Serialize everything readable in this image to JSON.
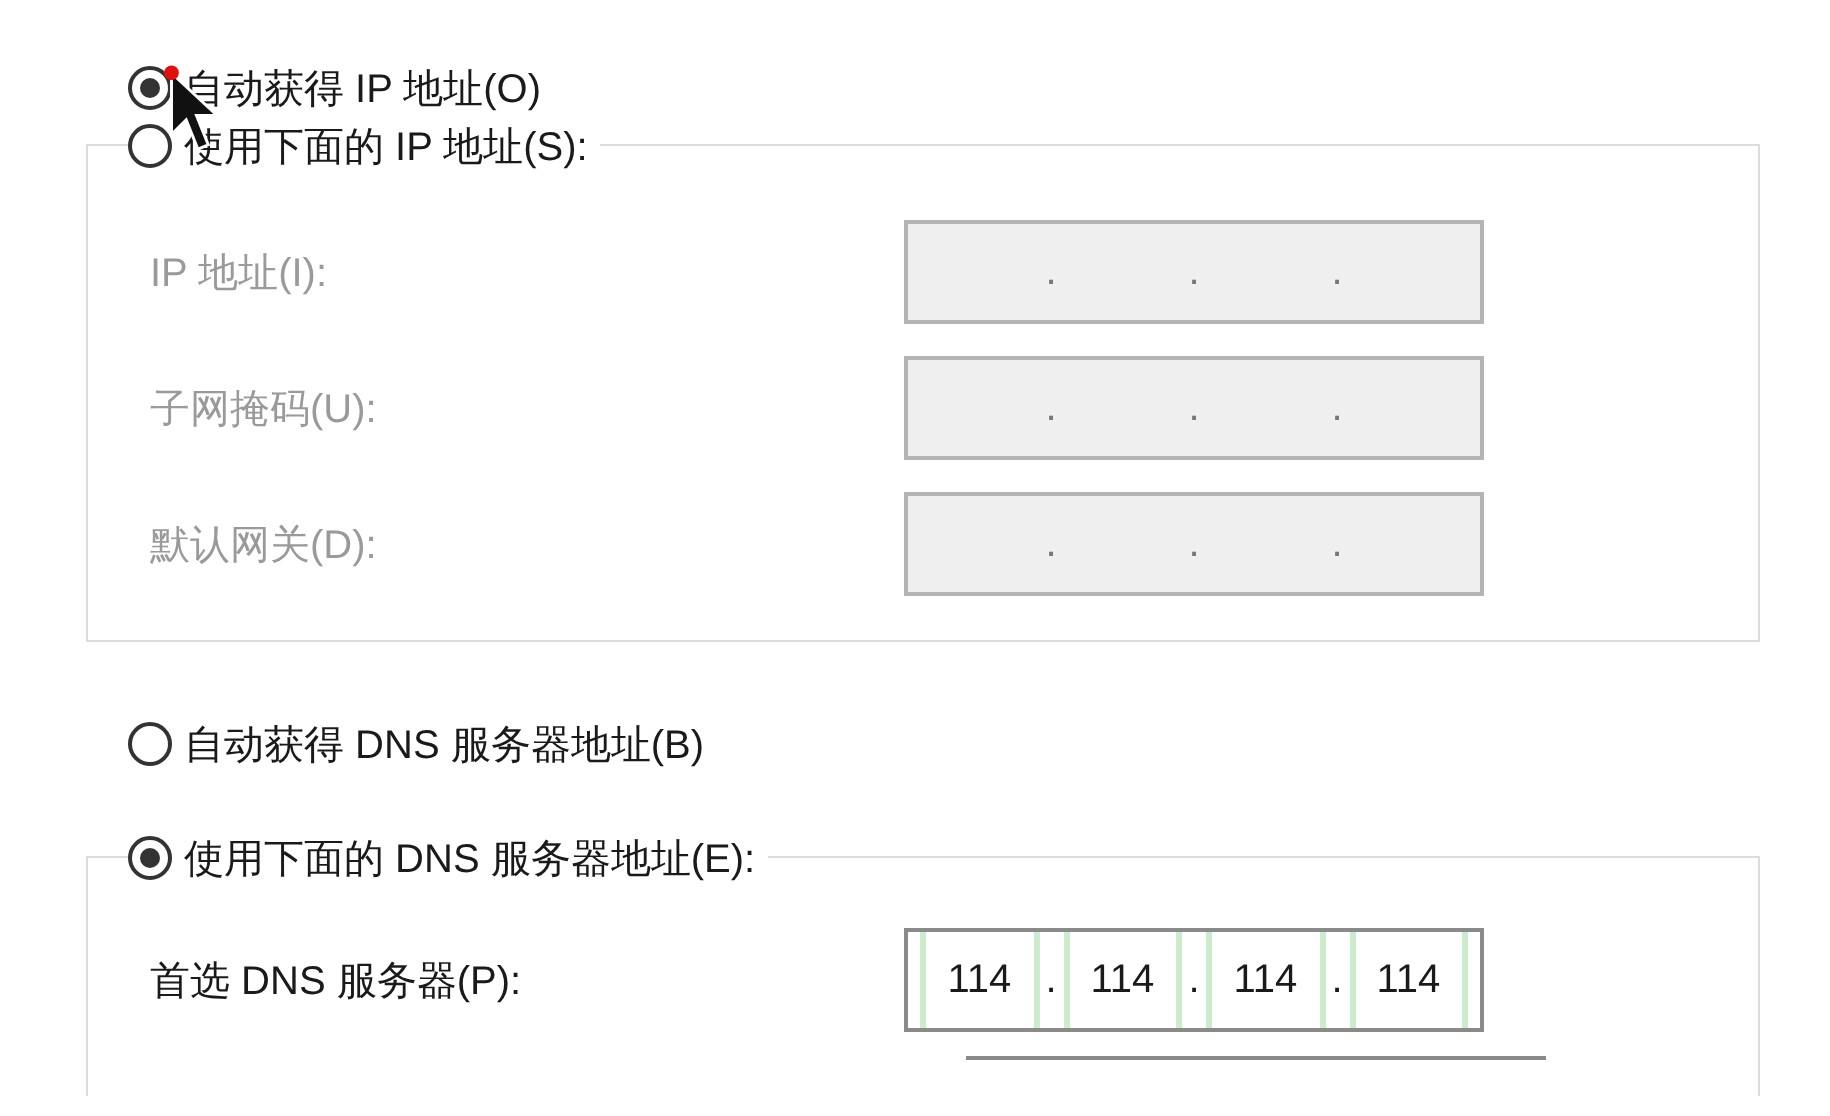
{
  "ip_mode": [
    {
      "label": "自动获得 IP 地址(O)",
      "selected": true
    }
  ],
  "ip_group": {
    "radio": {
      "label": "使用下面的 IP 地址(S):",
      "selected": false
    },
    "fields": [
      {
        "label": "IP 地址(I):",
        "disabled": true,
        "separator": "."
      },
      {
        "label": "子网掩码(U):",
        "disabled": true,
        "separator": "."
      },
      {
        "label": "默认网关(D):",
        "disabled": true,
        "separator": "."
      }
    ]
  },
  "dns_mode": [
    {
      "label": "自动获得 DNS 服务器地址(B)",
      "selected": false
    }
  ],
  "dns_group": {
    "radio": {
      "label": "使用下面的 DNS 服务器地址(E):",
      "selected": true
    },
    "fields": [
      {
        "label": "首选 DNS 服务器(P):",
        "disabled": false,
        "separator": ".",
        "octets": [
          "114",
          "114",
          "114",
          "114"
        ]
      }
    ]
  }
}
